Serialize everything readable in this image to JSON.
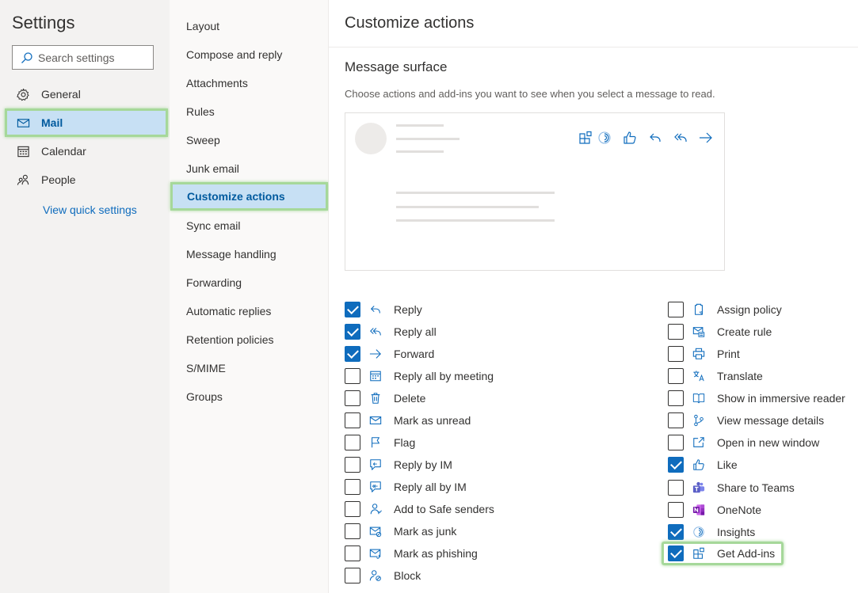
{
  "left_nav": {
    "title": "Settings",
    "search_placeholder": "Search settings",
    "items": [
      {
        "label": "General",
        "icon": "gear-icon"
      },
      {
        "label": "Mail",
        "icon": "mail-icon",
        "selected": true
      },
      {
        "label": "Calendar",
        "icon": "calendar-icon"
      },
      {
        "label": "People",
        "icon": "people-icon"
      }
    ],
    "quick_settings_link": "View quick settings"
  },
  "sub_nav": {
    "items": [
      {
        "label": "Layout"
      },
      {
        "label": "Compose and reply"
      },
      {
        "label": "Attachments"
      },
      {
        "label": "Rules"
      },
      {
        "label": "Sweep"
      },
      {
        "label": "Junk email"
      },
      {
        "label": "Customize actions",
        "selected": true
      },
      {
        "label": "Sync email"
      },
      {
        "label": "Message handling"
      },
      {
        "label": "Forwarding"
      },
      {
        "label": "Automatic replies"
      },
      {
        "label": "Retention policies"
      },
      {
        "label": "S/MIME"
      },
      {
        "label": "Groups"
      }
    ]
  },
  "main": {
    "title": "Customize actions",
    "section_title": "Message surface",
    "section_description": "Choose actions and add-ins you want to see when you select a message to read.",
    "preview_icons": [
      "get-add-ins-icon",
      "insights-icon",
      "like-icon",
      "reply-icon",
      "reply-all-icon",
      "forward-icon"
    ],
    "left_options": [
      {
        "label": "Reply",
        "checked": true,
        "icon": "reply-icon"
      },
      {
        "label": "Reply all",
        "checked": true,
        "icon": "reply-all-icon"
      },
      {
        "label": "Forward",
        "checked": true,
        "icon": "forward-icon"
      },
      {
        "label": "Reply all by meeting",
        "checked": false,
        "icon": "calendar-icon"
      },
      {
        "label": "Delete",
        "checked": false,
        "icon": "trash-icon"
      },
      {
        "label": "Mark as unread",
        "checked": false,
        "icon": "envelope-icon"
      },
      {
        "label": "Flag",
        "checked": false,
        "icon": "flag-icon"
      },
      {
        "label": "Reply by IM",
        "checked": false,
        "icon": "chat-icon"
      },
      {
        "label": "Reply all by IM",
        "checked": false,
        "icon": "chat-icon"
      },
      {
        "label": "Add to Safe senders",
        "checked": false,
        "icon": "person-add-icon"
      },
      {
        "label": "Mark as junk",
        "checked": false,
        "icon": "junk-icon"
      },
      {
        "label": "Mark as phishing",
        "checked": false,
        "icon": "phishing-icon"
      },
      {
        "label": "Block",
        "checked": false,
        "icon": "block-icon"
      }
    ],
    "right_options": [
      {
        "label": "Assign policy",
        "checked": false,
        "icon": "policy-icon"
      },
      {
        "label": "Create rule",
        "checked": false,
        "icon": "rule-icon"
      },
      {
        "label": "Print",
        "checked": false,
        "icon": "print-icon"
      },
      {
        "label": "Translate",
        "checked": false,
        "icon": "translate-icon"
      },
      {
        "label": "Show in immersive reader",
        "checked": false,
        "icon": "immersive-reader-icon"
      },
      {
        "label": "View message details",
        "checked": false,
        "icon": "details-icon"
      },
      {
        "label": "Open in new window",
        "checked": false,
        "icon": "open-window-icon"
      },
      {
        "label": "Like",
        "checked": true,
        "icon": "like-icon"
      },
      {
        "label": "Share to Teams",
        "checked": false,
        "icon": "teams-icon"
      },
      {
        "label": "OneNote",
        "checked": false,
        "icon": "onenote-icon"
      },
      {
        "label": "Insights",
        "checked": true,
        "icon": "insights-icon"
      },
      {
        "label": "Get Add-ins",
        "checked": true,
        "icon": "get-add-ins-icon",
        "highlighted": true
      }
    ]
  },
  "colors": {
    "accent": "#0f6cbd",
    "selected_bg": "#c7e0f4",
    "highlight_border": "#a6d89a",
    "teams": "#5b5fc7",
    "onenote": "#7719aa"
  }
}
